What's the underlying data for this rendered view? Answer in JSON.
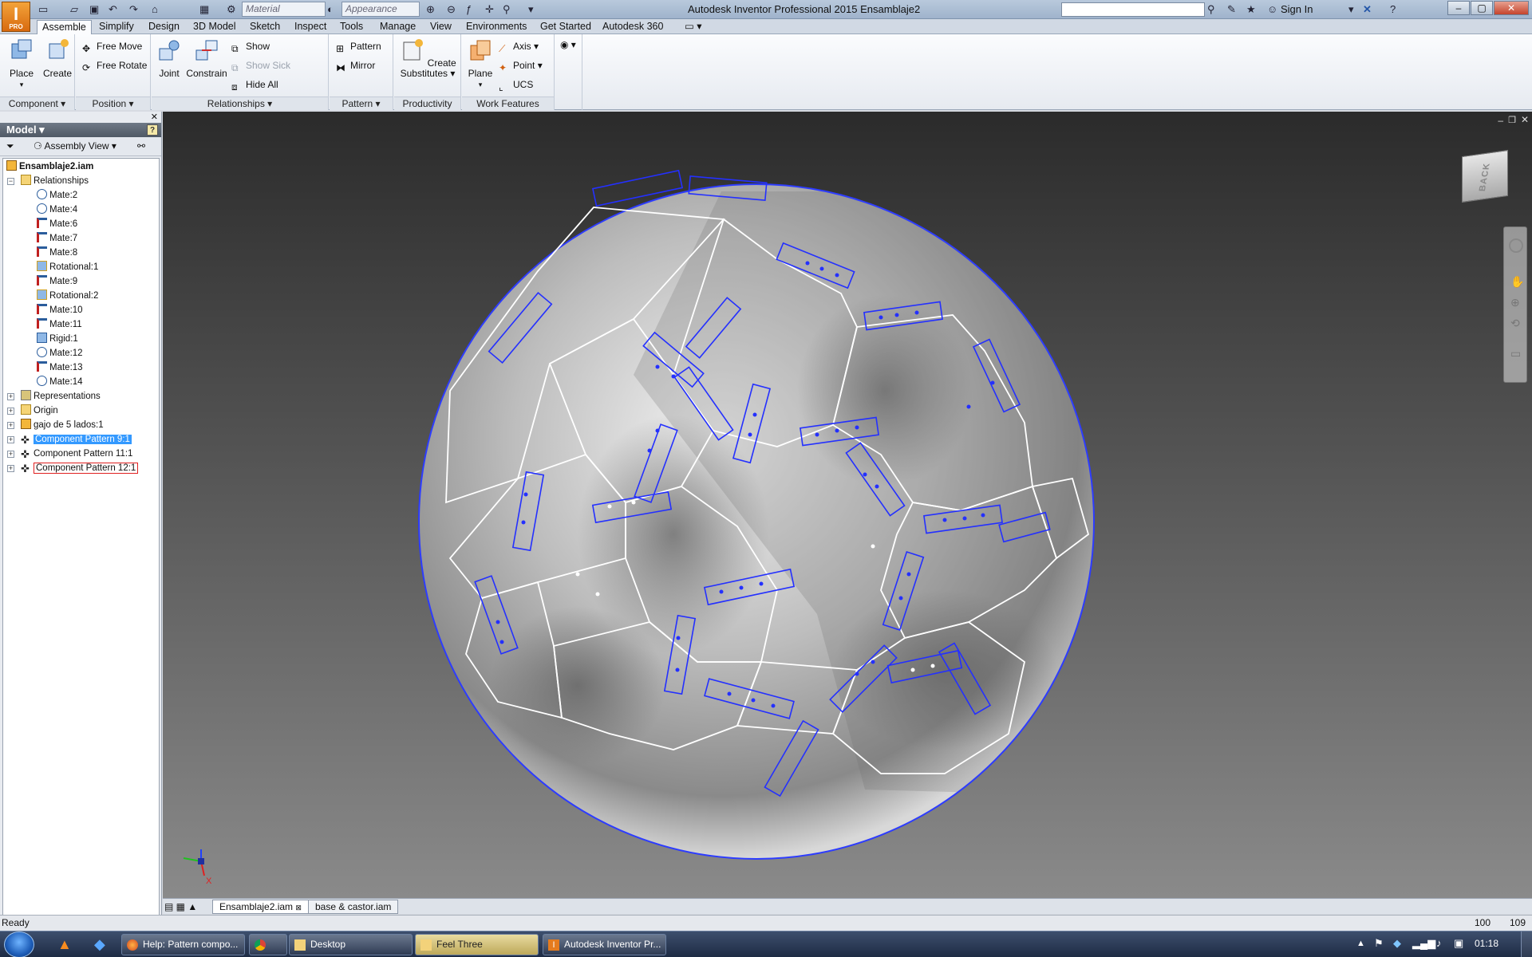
{
  "titlebar": {
    "window_title": "Autodesk Inventor Professional 2015    Ensamblaje2",
    "logo_text": "I",
    "logo_sub": "PRO",
    "material_placeholder": "Material",
    "appearance_placeholder": "Appearance",
    "sign_in": "Sign In"
  },
  "menu": {
    "tabs": [
      "Assemble",
      "Simplify",
      "Design",
      "3D Model",
      "Sketch",
      "Inspect",
      "Tools",
      "Manage",
      "View",
      "Environments",
      "Get Started",
      "Autodesk 360"
    ]
  },
  "ribbon": {
    "place": "Place",
    "create": "Create",
    "free_move": "Free Move",
    "free_rotate": "Free Rotate",
    "joint": "Joint",
    "constrain": "Constrain",
    "show": "Show",
    "show_sick": "Show Sick",
    "hide_all": "Hide All",
    "pattern": "Pattern",
    "mirror": "Mirror",
    "create_substitutes_1": "Create",
    "create_substitutes_2": "Substitutes",
    "plane": "Plane",
    "axis": "Axis",
    "point": "Point",
    "ucs": "UCS",
    "panels": {
      "component": "Component",
      "position": "Position",
      "relationships": "Relationships",
      "pattern": "Pattern",
      "productivity": "Productivity",
      "work_features": "Work Features"
    }
  },
  "browser": {
    "title": "Model",
    "view": "Assembly View",
    "help": "?",
    "root": "Ensamblaje2.iam",
    "relationships_folder": "Relationships",
    "constraints": [
      "Mate:2",
      "Mate:4",
      "Mate:6",
      "Mate:7",
      "Mate:8",
      "Rotational:1",
      "Mate:9",
      "Rotational:2",
      "Mate:10",
      "Mate:11",
      "Rigid:1",
      "Mate:12",
      "Mate:13",
      "Mate:14"
    ],
    "representations": "Representations",
    "origin": "Origin",
    "part": "gajo de 5 lados:1",
    "patterns": [
      "Component Pattern 9:1",
      "Component Pattern 11:1",
      "Component Pattern 12:1"
    ]
  },
  "viewcube": {
    "face": "BACK"
  },
  "triad": {
    "x_label": "X"
  },
  "doc_tabs": [
    "Ensamblaje2.iam",
    "base & castor.iam"
  ],
  "status": {
    "text": "Ready",
    "count1": "100",
    "count2": "109"
  },
  "taskbar": {
    "items": [
      "Help: Pattern compo...",
      "",
      "Desktop",
      "Feel Three",
      "Autodesk Inventor Pr..."
    ],
    "clock": "01:18"
  }
}
